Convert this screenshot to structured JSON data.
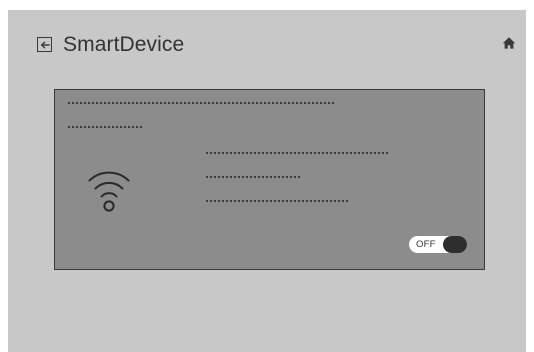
{
  "header": {
    "title": "SmartDevice",
    "back_icon": "back-arrow-icon",
    "home_icon": "home-icon"
  },
  "card": {
    "icon": "wifi-icon",
    "toggle": {
      "label": "OFF",
      "state": "off"
    }
  },
  "colors": {
    "screen_background": "#c8c8c8",
    "card_background": "#8c8c8c",
    "card_border": "#3a3a3a",
    "text": "#333333",
    "toggle_knob": "#2e2e2e"
  }
}
